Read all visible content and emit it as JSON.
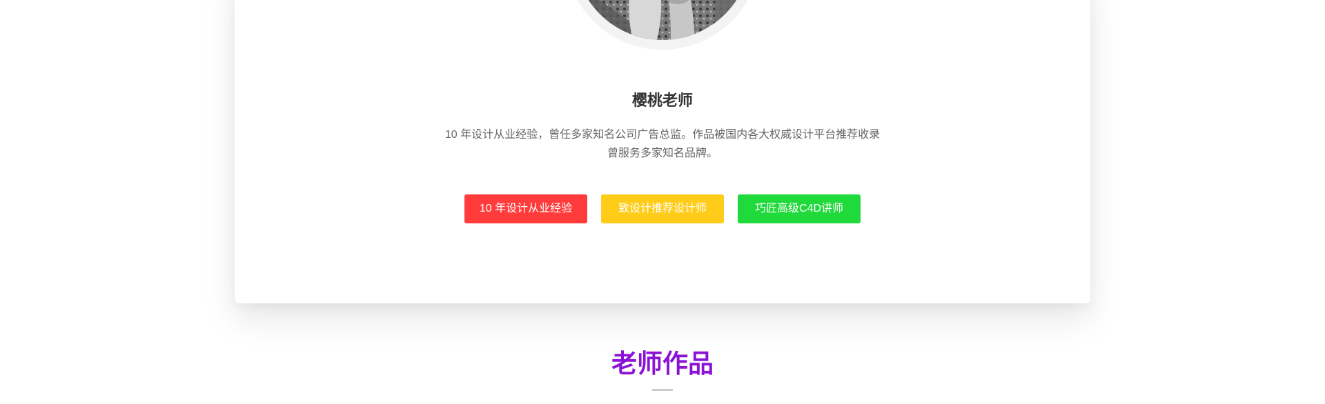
{
  "teacher": {
    "name": "樱桃老师",
    "bio_line1": "10 年设计从业经验，曾任多家知名公司广告总监。作品被国内各大权威设计平台推荐收录",
    "bio_line2": "曾服务多家知名品牌。",
    "tags": [
      {
        "label": "10 年设计从业经验",
        "color": "#ff3b3b"
      },
      {
        "label": "致设计推荐设计师",
        "color": "#ffcc1a"
      },
      {
        "label": "巧匠高级C4D讲师",
        "color": "#20d93a"
      }
    ]
  },
  "works_section": {
    "title": "老师作品",
    "title_color": "#8b13d6"
  }
}
